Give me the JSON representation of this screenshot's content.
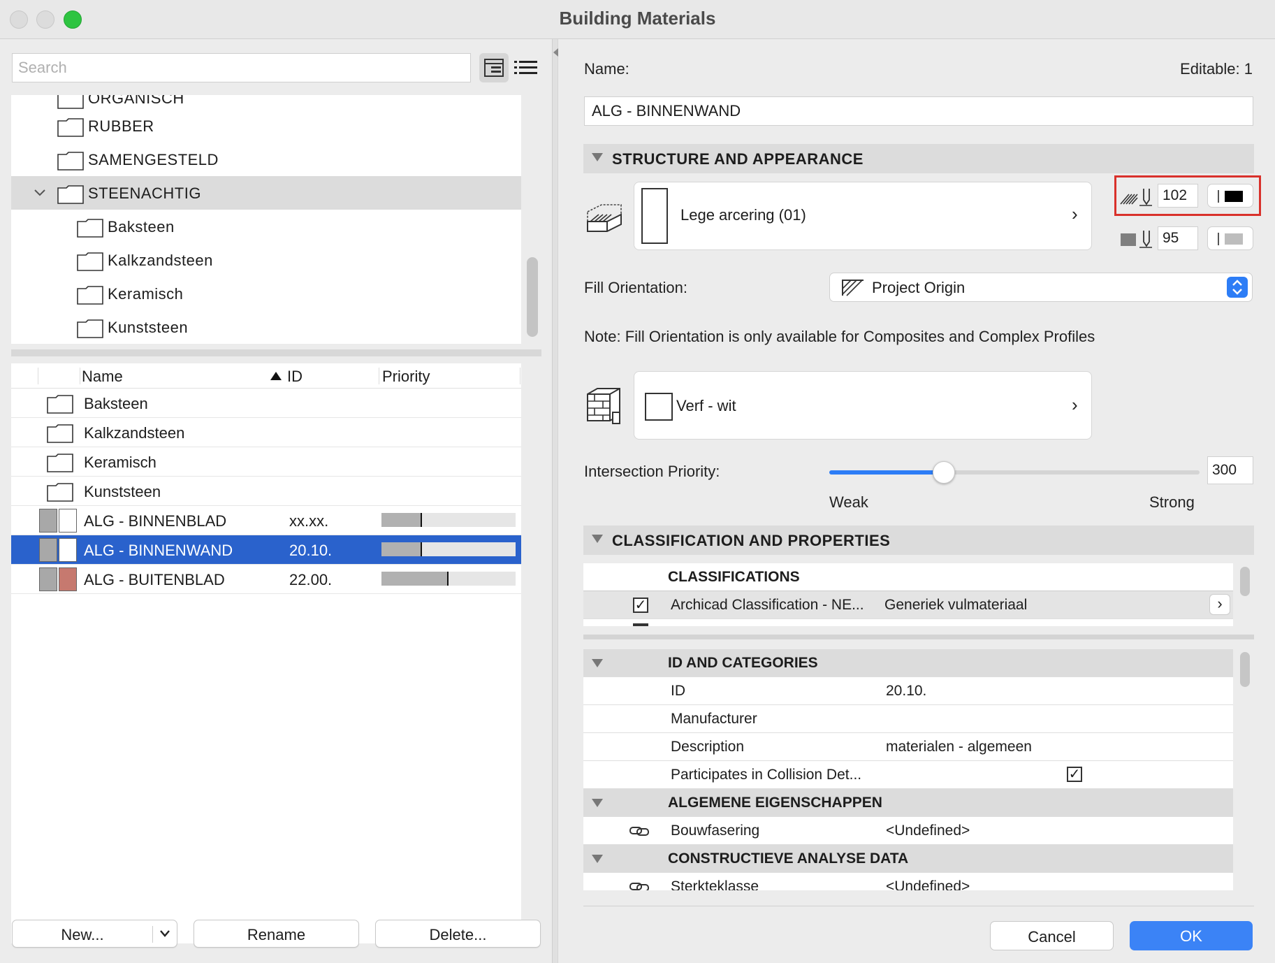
{
  "window": {
    "title": "Building Materials"
  },
  "left": {
    "search_placeholder": "Search",
    "tree": {
      "cut_label": "ORGANISCH",
      "items": [
        {
          "label": "RUBBER"
        },
        {
          "label": "SAMENGESTELD"
        },
        {
          "label": "STEENACHTIG"
        },
        {
          "label": "Baksteen"
        },
        {
          "label": "Kalkzandsteen"
        },
        {
          "label": "Keramisch"
        },
        {
          "label": "Kunststeen"
        }
      ]
    },
    "list": {
      "columns": {
        "name": "Name",
        "id": "ID",
        "priority": "Priority"
      },
      "folders": [
        {
          "label": "Baksteen"
        },
        {
          "label": "Kalkzandsteen"
        },
        {
          "label": "Keramisch"
        },
        {
          "label": "Kunststeen"
        }
      ],
      "materials": [
        {
          "name": "ALG - BINNENBLAD",
          "id": "xx.xx.",
          "priority": 0.3,
          "color": "#ffffff"
        },
        {
          "name": "ALG - BINNENWAND",
          "id": "20.10.",
          "priority": 0.3,
          "color": "#ffffff"
        },
        {
          "name": "ALG - BUITENBLAD",
          "id": "22.00.",
          "priority": 0.5,
          "color": "#c6796f"
        }
      ]
    },
    "buttons": {
      "new": "New...",
      "rename": "Rename",
      "delete": "Delete..."
    }
  },
  "right": {
    "name_label": "Name:",
    "editable_label": "Editable: 1",
    "name_value": "ALG - BINNENWAND",
    "structure": {
      "section_title": "STRUCTURE AND APPEARANCE",
      "fill_name": "Lege arcering (01)",
      "pen_fill": "102",
      "pen_background": "95",
      "fill_orientation_label": "Fill Orientation:",
      "fill_orientation_value": "Project Origin",
      "note": "Note: Fill Orientation is only available for Composites and Complex Profiles",
      "surface_name": "Verf - wit",
      "intersection_label": "Intersection Priority:",
      "intersection_value": "300",
      "intersection_level": 0.31,
      "weak_label": "Weak",
      "strong_label": "Strong"
    },
    "classification": {
      "section_title": "CLASSIFICATION AND PROPERTIES",
      "classifications_header": "CLASSIFICATIONS",
      "classification_row": {
        "system": "Archicad Classification - NE...",
        "value": "Generiek vulmateriaal"
      },
      "groups": [
        {
          "title": "ID AND CATEGORIES",
          "rows": [
            {
              "key": "ID",
              "value": "20.10."
            },
            {
              "key": "Manufacturer",
              "value": ""
            },
            {
              "key": "Description",
              "value": "materialen - algemeen"
            },
            {
              "key": "Participates in Collision Det...",
              "value": ""
            }
          ]
        },
        {
          "title": "ALGEMENE EIGENSCHAPPEN",
          "rows": [
            {
              "key": "Bouwfasering",
              "value": "<Undefined>"
            }
          ]
        },
        {
          "title": "CONSTRUCTIEVE ANALYSE DATA",
          "rows": [
            {
              "key": "Sterkteklasse",
              "value": "<Undefined>"
            }
          ]
        }
      ]
    },
    "buttons": {
      "cancel": "Cancel",
      "ok": "OK"
    }
  },
  "colors": {
    "accent": "#2a62cc",
    "ok_button": "#3b83f6",
    "highlight_box": "#d9312b"
  }
}
